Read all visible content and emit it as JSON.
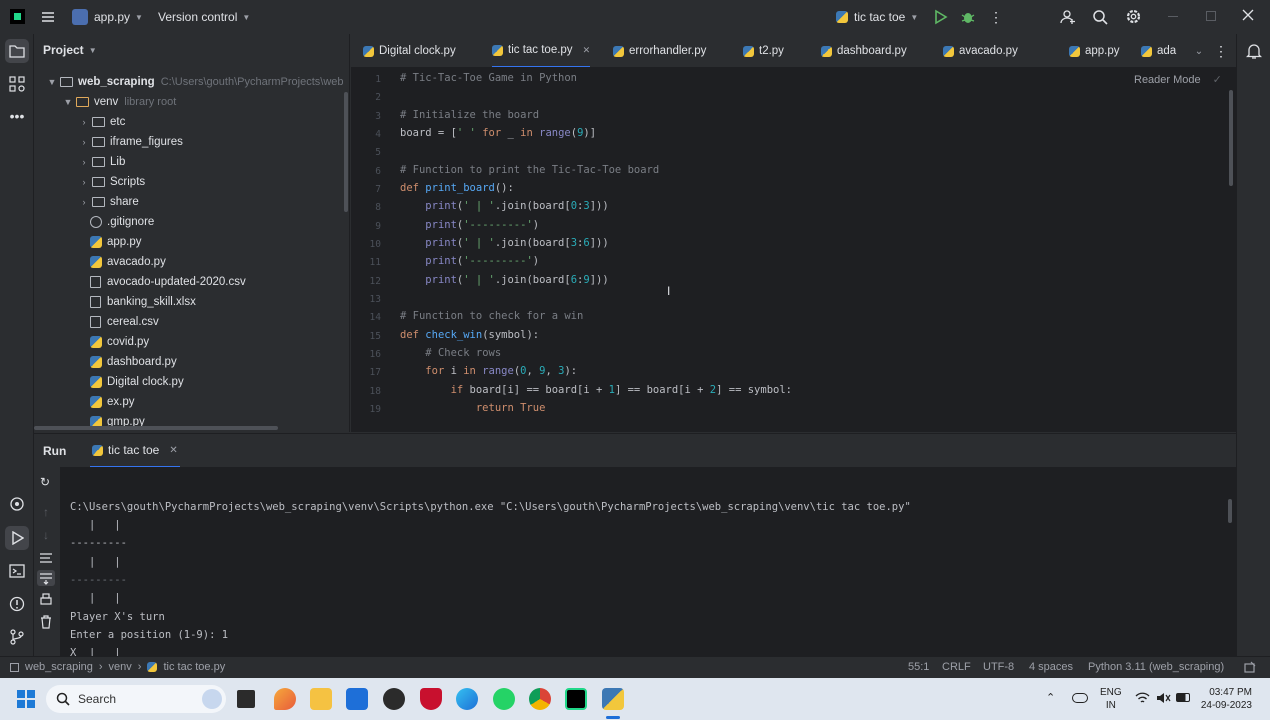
{
  "titlebar": {
    "file_menu": "app.py",
    "vcs": "Version control",
    "run_config": "tic tac toe"
  },
  "project": {
    "title": "Project",
    "root": {
      "name": "web_scraping",
      "path": "C:\\Users\\gouth\\PycharmProjects\\web"
    },
    "venv": {
      "name": "venv",
      "hint": "library root"
    },
    "items": [
      {
        "label": "etc",
        "type": "folder"
      },
      {
        "label": "iframe_figures",
        "type": "folder"
      },
      {
        "label": "Lib",
        "type": "folder"
      },
      {
        "label": "Scripts",
        "type": "folder"
      },
      {
        "label": "share",
        "type": "folder"
      },
      {
        "label": ".gitignore",
        "type": "file"
      },
      {
        "label": "app.py",
        "type": "py"
      },
      {
        "label": "avacado.py",
        "type": "py"
      },
      {
        "label": "avocado-updated-2020.csv",
        "type": "csv"
      },
      {
        "label": "banking_skill.xlsx",
        "type": "csv"
      },
      {
        "label": "cereal.csv",
        "type": "csv"
      },
      {
        "label": "covid.py",
        "type": "py"
      },
      {
        "label": "dashboard.py",
        "type": "py"
      },
      {
        "label": "Digital clock.py",
        "type": "py"
      },
      {
        "label": "ex.py",
        "type": "py"
      },
      {
        "label": "gmp.py",
        "type": "py"
      }
    ]
  },
  "tabs": [
    {
      "label": "Digital clock.py"
    },
    {
      "label": "tic tac toe.py"
    },
    {
      "label": "errorhandler.py"
    },
    {
      "label": "t2.py"
    },
    {
      "label": "dashboard.py"
    },
    {
      "label": "avacado.py"
    },
    {
      "label": "app.py"
    },
    {
      "label": "ada"
    }
  ],
  "editor": {
    "reader_mode": "Reader Mode",
    "line_numbers": [
      "1",
      "2",
      "3",
      "4",
      "5",
      "6",
      "7",
      "8",
      "9",
      "10",
      "11",
      "12",
      "13",
      "14",
      "15",
      "16",
      "17",
      "18",
      "19"
    ]
  },
  "run": {
    "title": "Run",
    "tab": "tic tac toe",
    "lines": [
      "C:\\Users\\gouth\\PycharmProjects\\web_scraping\\venv\\Scripts\\python.exe \"C:\\Users\\gouth\\PycharmProjects\\web_scraping\\venv\\tic tac toe.py\"",
      "   |   |",
      "---------",
      "   |   |",
      "---------",
      "   |   |",
      "Player X's turn",
      "Enter a position (1-9): 1",
      "X  |   |"
    ]
  },
  "status": {
    "breadcrumb": [
      "web_scraping",
      "venv",
      "tic tac toe.py"
    ],
    "position": "55:1",
    "line_sep": "CRLF",
    "encoding": "UTF-8",
    "indent": "4 spaces",
    "interpreter": "Python 3.11 (web_scraping)"
  },
  "taskbar": {
    "search": "Search",
    "lang": "ENG",
    "region": "IN",
    "time": "03:47 PM",
    "date": "24-09-2023"
  },
  "colors": {
    "accent": "#3574f0",
    "editor_bg": "#1e1f22",
    "panel_bg": "#2b2d30"
  }
}
